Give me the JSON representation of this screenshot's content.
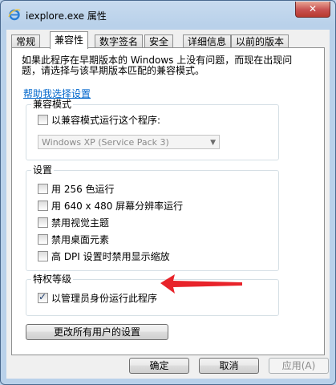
{
  "window": {
    "title": "iexplore.exe 属性",
    "close_label": "✕"
  },
  "tabs": [
    {
      "label": "常规"
    },
    {
      "label": "兼容性"
    },
    {
      "label": "数字签名"
    },
    {
      "label": "安全"
    },
    {
      "label": "详细信息"
    },
    {
      "label": "以前的版本"
    }
  ],
  "active_tab": "兼容性",
  "compat": {
    "intro": "如果此程序在早期版本的 Windows 上没有问题，而现在出现问题，请选择与该早期版本匹配的兼容模式。",
    "help_link": "帮助我选择设置",
    "mode_group": {
      "title": "兼容模式",
      "checkbox_label": "以兼容模式运行这个程序:",
      "checked": false,
      "os_selected": "Windows XP (Service Pack 3)"
    },
    "settings_group": {
      "title": "设置",
      "options": [
        {
          "label": "用 256 色运行",
          "checked": false
        },
        {
          "label": "用 640 x 480 屏幕分辨率运行",
          "checked": false
        },
        {
          "label": "禁用视觉主题",
          "checked": false
        },
        {
          "label": "禁用桌面元素",
          "checked": false
        },
        {
          "label": "高 DPI 设置时禁用显示缩放",
          "checked": false
        }
      ]
    },
    "privilege_group": {
      "title": "特权等级",
      "checkbox_label": "以管理员身份运行此程序",
      "checked": true
    },
    "all_users_button": "更改所有用户的设置"
  },
  "buttons": {
    "ok": "确定",
    "cancel": "取消",
    "apply": "应用(A)"
  },
  "colors": {
    "annotation_arrow": "#e8232a",
    "link": "#0066cc"
  }
}
